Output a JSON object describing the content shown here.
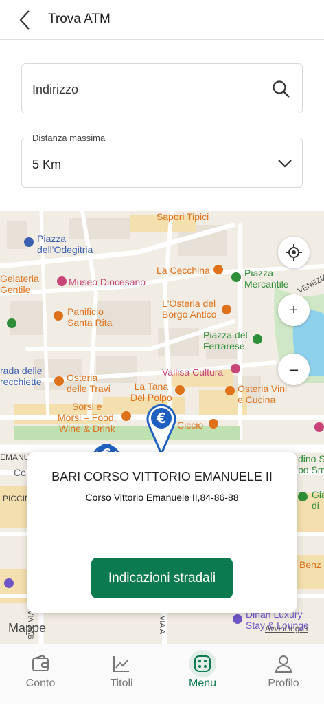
{
  "header": {
    "title": "Trova ATM"
  },
  "address_field": {
    "placeholder": "Indirizzo"
  },
  "distance_field": {
    "label": "Distanza massima",
    "value": "5 Km"
  },
  "map": {
    "labels": [
      {
        "text": "Sapori Tipici",
        "color": "orange"
      },
      {
        "text": "Piazza\ndell'Odegitria",
        "color": "blue"
      },
      {
        "text": "Museo Diocesano",
        "color": "pink"
      },
      {
        "text": "Gelateria\nGentile",
        "color": "orange"
      },
      {
        "text": "La Cecchina",
        "color": "orange"
      },
      {
        "text": "Piazza\nMercantile",
        "color": "green"
      },
      {
        "text": "VENEZIA",
        "color": "dark"
      },
      {
        "text": "Panificio\nSanta Rita",
        "color": "orange"
      },
      {
        "text": "L'Osteria del\nBorgo Antico",
        "color": "orange"
      },
      {
        "text": "Piazza del\nFerrarese",
        "color": "green"
      },
      {
        "text": "rada delle\nrecchiette",
        "color": "blue"
      },
      {
        "text": "Osteria\ndelle Travi",
        "color": "orange"
      },
      {
        "text": "Vallisa Cultura",
        "color": "pink"
      },
      {
        "text": "La Tana\nDel Polpo",
        "color": "orange"
      },
      {
        "text": "Osteria Vini\ne Cucina",
        "color": "orange"
      },
      {
        "text": "Sorsi e\nMorsi – Food,\nWine & Drink",
        "color": "orange"
      },
      {
        "text": "Ciccio",
        "color": "orange"
      },
      {
        "text": "EMANU",
        "color": "dark"
      },
      {
        "text": "Co",
        "color": "dark"
      },
      {
        "text": "PICCIN",
        "color": "dark"
      },
      {
        "text": "dino S\npo Sm",
        "color": "green"
      },
      {
        "text": "Gia\ndi",
        "color": "green"
      },
      {
        "text": "Benz",
        "color": "orange"
      },
      {
        "text": "Dinan Luxury\nStay & Lounge",
        "color": "purple"
      },
      {
        "text": "VIA A",
        "color": "dark"
      },
      {
        "text": "VIA DAB",
        "color": "dark"
      }
    ],
    "controls": {
      "locate": "locate-icon",
      "zoom_in": "+",
      "zoom_out": "–"
    },
    "attribution": "Mappe",
    "legal": "Avvisi legali"
  },
  "atm_card": {
    "name": "BARI CORSO VITTORIO EMANUELE II",
    "address": "Corso Vittorio Emanuele II,84-86-88",
    "directions_label": "Indicazioni stradali"
  },
  "tabbar": {
    "items": [
      {
        "label": "Conto",
        "icon": "wallet-icon"
      },
      {
        "label": "Titoli",
        "icon": "chart-icon"
      },
      {
        "label": "Menu",
        "icon": "menu-grid-icon",
        "active": true
      },
      {
        "label": "Profilo",
        "icon": "person-icon"
      }
    ]
  },
  "colors": {
    "accent": "#0c7a4f",
    "pin": "#1f5fbf",
    "map_orange": "#e0711b",
    "map_green": "#2f8e3a"
  }
}
